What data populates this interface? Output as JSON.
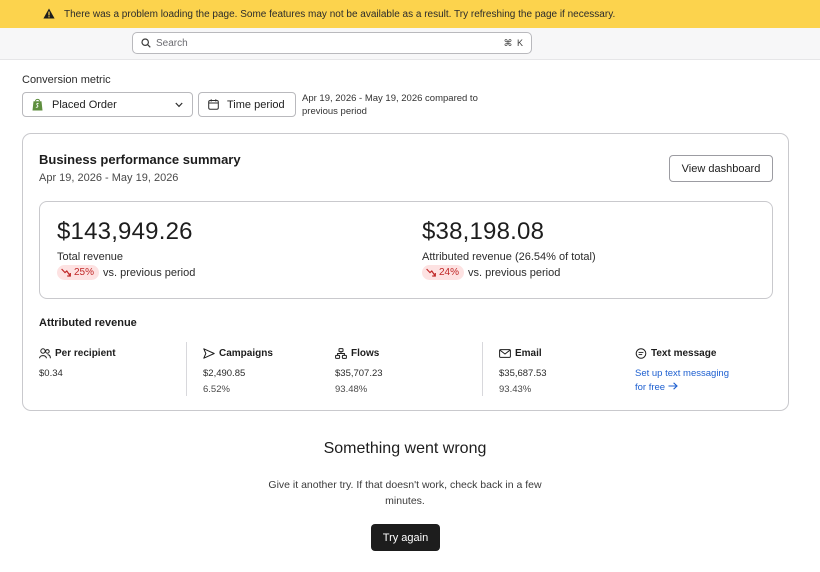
{
  "banner": {
    "icon": "warning-triangle-icon",
    "message": "There was a problem loading the page. Some features may not be available as a result. Try refreshing the page if necessary."
  },
  "search": {
    "placeholder": "Search",
    "shortcut": "⌘ K",
    "icon": "search-icon"
  },
  "filters": {
    "conversion_metric_label": "Conversion metric",
    "conversion_metric_value": "Placed Order",
    "conversion_metric_icon": "shopify-bag-icon",
    "time_period_label": "Time period",
    "time_period_icon": "calendar-icon",
    "date_range_line1": "Apr 19, 2026 - May 19, 2026 compared to",
    "date_range_line2": "previous period"
  },
  "summary": {
    "title": "Business performance summary",
    "date_range": "Apr 19, 2026 - May 19, 2026",
    "view_dashboard_label": "View dashboard",
    "total_revenue": {
      "value": "$143,949.26",
      "label": "Total revenue",
      "change": "25%",
      "change_direction": "down",
      "comparison": "vs. previous period"
    },
    "attributed_revenue": {
      "value": "$38,198.08",
      "label": "Attributed revenue (26.54% of total)",
      "change": "24%",
      "change_direction": "down",
      "comparison": "vs. previous period"
    }
  },
  "attributed": {
    "title": "Attributed revenue",
    "per_recipient": {
      "label": "Per recipient",
      "value": "$0.34",
      "icon": "people-icon"
    },
    "campaigns": {
      "label": "Campaigns",
      "value": "$2,490.85",
      "share": "6.52%",
      "icon": "send-icon"
    },
    "flows": {
      "label": "Flows",
      "value": "$35,707.23",
      "share": "93.48%",
      "icon": "flow-icon"
    },
    "email": {
      "label": "Email",
      "value": "$35,687.53",
      "share": "93.43%",
      "icon": "envelope-icon"
    },
    "text_message": {
      "label": "Text message",
      "link_line1": "Set up text messaging",
      "link_line2": "for free",
      "icon": "chat-bubble-icon"
    }
  },
  "error": {
    "title": "Something went wrong",
    "message": "Give it another try. If that doesn't work, check back in a few minutes.",
    "retry_label": "Try again"
  },
  "colors": {
    "banner_bg": "#fcd34d",
    "negative_pill_bg": "#fde2e2",
    "negative_text": "#c02626",
    "link": "#1d5fd0",
    "primary_button": "#1d1d1d"
  }
}
